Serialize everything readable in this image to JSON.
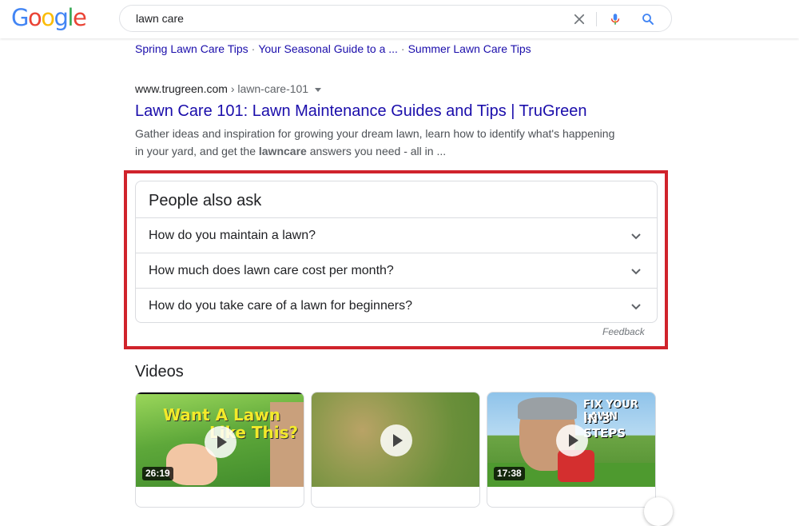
{
  "search": {
    "query": "lawn care"
  },
  "logo": {
    "text": "Google"
  },
  "sitelinks": [
    "Spring Lawn Care Tips",
    "Your Seasonal Guide to a ...",
    "Summer Lawn Care Tips"
  ],
  "result": {
    "domain": "www.trugreen.com",
    "path": " › lawn-care-101",
    "title": "Lawn Care 101: Lawn Maintenance Guides and Tips | TruGreen",
    "snippet_before": "Gather ideas and inspiration for growing your dream lawn, learn how to identify what's happening in your yard, and get the ",
    "snippet_bold": "lawncare",
    "snippet_after": " answers you need - all in ..."
  },
  "paa": {
    "title": "People also ask",
    "questions": [
      "How do you maintain a lawn?",
      "How much does lawn care cost per month?",
      "How do you take care of a lawn for beginners?"
    ],
    "feedback": "Feedback"
  },
  "videos": {
    "heading": "Videos",
    "items": [
      {
        "duration": "26:19",
        "overlay_line1": "Want A Lawn",
        "overlay_line2": "Like This?"
      },
      {
        "duration": "",
        "overlay_line1": "",
        "overlay_line2": ""
      },
      {
        "duration": "17:38",
        "overlay_line1": "FIX YOUR LAWN",
        "overlay_line2": "IN 3 STEPS"
      }
    ]
  },
  "colors": {
    "link": "#1a0dab",
    "highlight_border": "#d0232b",
    "logo_blue": "#4285f4",
    "logo_red": "#ea4335",
    "logo_yellow": "#fbbc05",
    "logo_green": "#34a853"
  }
}
